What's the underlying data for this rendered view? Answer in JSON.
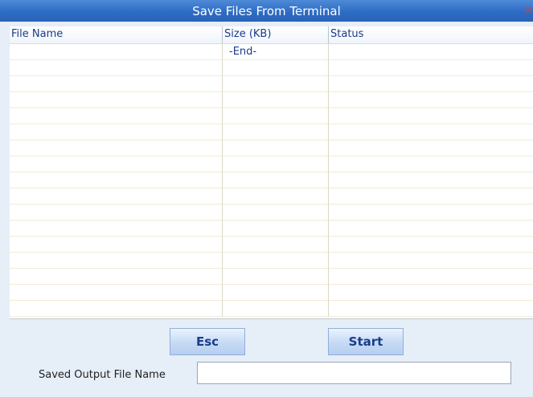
{
  "window": {
    "title": "Save Files From Terminal",
    "close_glyph": "✕"
  },
  "table": {
    "columns": [
      "File Name",
      "Size (KB)",
      "Status"
    ],
    "rows": [
      [
        "",
        "-End-",
        ""
      ],
      [
        "",
        "",
        ""
      ],
      [
        "",
        "",
        ""
      ],
      [
        "",
        "",
        ""
      ],
      [
        "",
        "",
        ""
      ],
      [
        "",
        "",
        ""
      ],
      [
        "",
        "",
        ""
      ],
      [
        "",
        "",
        ""
      ],
      [
        "",
        "",
        ""
      ],
      [
        "",
        "",
        ""
      ],
      [
        "",
        "",
        ""
      ],
      [
        "",
        "",
        ""
      ],
      [
        "",
        "",
        ""
      ],
      [
        "",
        "",
        ""
      ],
      [
        "",
        "",
        ""
      ],
      [
        "",
        "",
        ""
      ],
      [
        "",
        "",
        ""
      ]
    ]
  },
  "footer": {
    "esc_label": "Esc",
    "start_label": "Start",
    "output_label": "Saved Output File Name",
    "output_value": ""
  },
  "colors": {
    "title_bar": "#2d6cc4",
    "header_text": "#1a3c8c",
    "panel_bg": "#e6eef8"
  }
}
